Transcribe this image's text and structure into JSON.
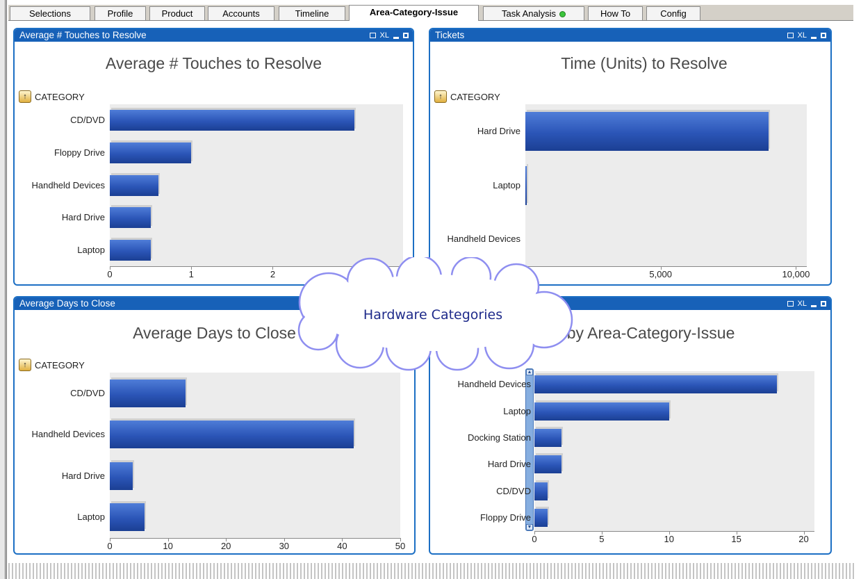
{
  "tabs": [
    {
      "label": "Selections"
    },
    {
      "label": "Profile"
    },
    {
      "label": "Product"
    },
    {
      "label": "Accounts"
    },
    {
      "label": "Timeline"
    },
    {
      "label": "Area-Category-Issue",
      "active": true
    },
    {
      "label": "Task Analysis",
      "indicator": "green-dot"
    },
    {
      "label": "How To"
    },
    {
      "label": "Config"
    }
  ],
  "panel_buttons": {
    "xl": "XL"
  },
  "panels": [
    {
      "header": "Average # Touches to Resolve",
      "title": "Average # Touches to Resolve",
      "dimension": "CATEGORY"
    },
    {
      "header": "Tickets",
      "title": "Time (Units) to Resolve",
      "dimension": "CATEGORY"
    },
    {
      "header": "Average Days to Close",
      "title": "Average Days to Close",
      "dimension": "CATEGORY"
    },
    {
      "header": "",
      "title": "...by Area-Category-Issue",
      "dimension": "CATEGORY"
    }
  ],
  "callout": {
    "text": "Hardware Categories",
    "colors": {
      "fill": "#ffffff",
      "outline": "#8e8ef0",
      "text": "#1e2a8a"
    }
  },
  "colors": {
    "panel_header": "#1761b8",
    "bar": "#2b55b7",
    "plot_bg": "#ececec"
  },
  "chart_data": [
    {
      "type": "bar",
      "orientation": "horizontal",
      "title": "Average # Touches to Resolve",
      "dimension_label": "CATEGORY",
      "categories": [
        "CD/DVD",
        "Floppy Drive",
        "Handheld Devices",
        "Hard Drive",
        "Laptop"
      ],
      "values": [
        3.0,
        1.0,
        0.6,
        0.5,
        0.5
      ],
      "xticks": [
        "0",
        "1",
        "2"
      ],
      "xlim": [
        0,
        3.6
      ]
    },
    {
      "type": "bar",
      "orientation": "horizontal",
      "title": "Time (Units) to Resolve",
      "dimension_label": "CATEGORY",
      "categories": [
        "Hard Drive",
        "Laptop",
        "Handheld Devices"
      ],
      "values": [
        9000,
        60,
        0
      ],
      "xticks": [
        "5,000",
        "10,000"
      ],
      "xlim": [
        0,
        10400
      ]
    },
    {
      "type": "bar",
      "orientation": "horizontal",
      "title": "Average Days to Close",
      "dimension_label": "CATEGORY",
      "categories": [
        "CD/DVD",
        "Handheld Devices",
        "Hard Drive",
        "Laptop"
      ],
      "values": [
        13,
        42,
        4,
        6
      ],
      "xticks": [
        "0",
        "10",
        "20",
        "30",
        "40",
        "50"
      ],
      "xlim": [
        0,
        50
      ]
    },
    {
      "type": "bar",
      "orientation": "horizontal",
      "title": "...by Area-Category-Issue",
      "categories": [
        "Handheld Devices",
        "Laptop",
        "Docking Station",
        "Hard Drive",
        "CD/DVD",
        "Floppy Drive"
      ],
      "values": [
        18,
        10,
        2,
        2,
        1,
        1
      ],
      "xticks": [
        "0",
        "5",
        "10",
        "15",
        "20"
      ],
      "xlim": [
        0,
        20.8
      ]
    }
  ]
}
